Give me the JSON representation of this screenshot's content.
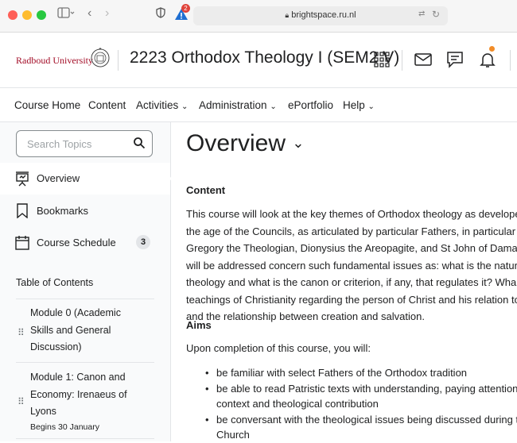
{
  "browser": {
    "url": "brightspace.ru.nl",
    "notification_count": "2"
  },
  "header": {
    "org_name": "Radboud University",
    "course_title": "2223 Orthodox Theology I (SEM2 V)"
  },
  "nav": {
    "items": [
      "Course Home",
      "Content",
      "Activities",
      "Administration",
      "ePortfolio",
      "Help"
    ]
  },
  "sidebar": {
    "search_placeholder": "Search Topics",
    "items": [
      {
        "label": "Overview",
        "icon": "presentation-icon"
      },
      {
        "label": "Bookmarks",
        "icon": "bookmark-icon"
      },
      {
        "label": "Course Schedule",
        "icon": "calendar-icon",
        "count": "3"
      }
    ],
    "toc_title": "Table of Contents",
    "modules": [
      {
        "lines": [
          "Module 0 (Academic",
          "Skills and General",
          "Discussion)"
        ]
      },
      {
        "lines": [
          "Module 1: Canon and",
          "Economy: Irenaeus of",
          "Lyons"
        ],
        "date": "Begins 30 January"
      }
    ]
  },
  "main": {
    "title": "Overview",
    "content_heading": "Content",
    "content_lines": [
      "This course will look at the key themes of Orthodox theology as develope",
      "the age of the Councils, as articulated by particular Fathers, in particular S",
      "Gregory the Theologian, Dionysius the Areopagite, and St John of Damas",
      "will be addressed concern such fundamental issues as: what is the nature",
      "theology and what is the canon or criterion, if any, that regulates it? Wha",
      "teachings of Christianity regarding the person of Christ and his relation to",
      "and the relationship between creation and salvation."
    ],
    "aims_heading": "Aims",
    "aims_intro": "Upon completion of this course, you will:",
    "bullets": [
      [
        "be familiar with select Fathers of the Orthodox tradition"
      ],
      [
        "be able to read Patristic texts with understanding, paying attention",
        "context and theological contribution"
      ],
      [
        "be conversant with the theological issues being discussed during t",
        "Church"
      ]
    ]
  },
  "colors": {
    "brand": "#a30d27",
    "accent": "#006fbf",
    "notify": "#f28c28"
  }
}
